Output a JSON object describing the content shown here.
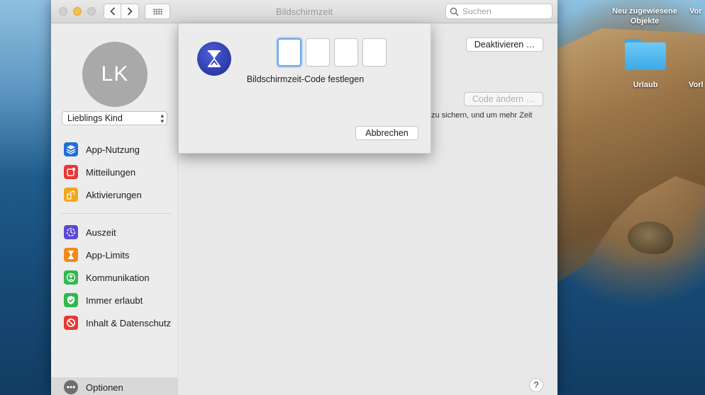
{
  "window": {
    "title": "Bildschirmzeit",
    "search_placeholder": "Suchen"
  },
  "sidebar": {
    "avatar_initials": "LK",
    "user_selected": "Lieblings Kind",
    "items_group1": [
      {
        "label": "App-Nutzung",
        "icon": "layers-icon",
        "color": "#1f6fd6"
      },
      {
        "label": "Mitteilungen",
        "icon": "notification-icon",
        "color": "#e53935"
      },
      {
        "label": "Aktivierungen",
        "icon": "pickup-icon",
        "color": "#f0a81a"
      }
    ],
    "items_group2": [
      {
        "label": "Auszeit",
        "icon": "downtime-icon",
        "color": "#5b49d6"
      },
      {
        "label": "App-Limits",
        "icon": "hourglass-icon",
        "color": "#ef8a1e"
      },
      {
        "label": "Kommunikation",
        "icon": "contact-icon",
        "color": "#30b94d"
      },
      {
        "label": "Immer erlaubt",
        "icon": "checkmark-icon",
        "color": "#30b94d"
      },
      {
        "label": "Inhalt & Datenschutz",
        "icon": "restriction-icon",
        "color": "#e53935"
      }
    ],
    "options_label": "Optionen"
  },
  "main": {
    "deactivate_label": "Deaktivieren …",
    "change_code_label": "Code ändern …",
    "partial_text": "zu sichern, und um mehr Zeit",
    "help_label": "?"
  },
  "sheet": {
    "code_label": "Bildschirmzeit-Code festlegen",
    "cancel_label": "Abbrechen",
    "code_digits": [
      "",
      "",
      "",
      ""
    ]
  },
  "desktop": {
    "item1_label": "Neu zugewiesene Objekte",
    "item2_label": "Vor",
    "folder_label": "Urlaub",
    "item3_label": "Vorl"
  }
}
